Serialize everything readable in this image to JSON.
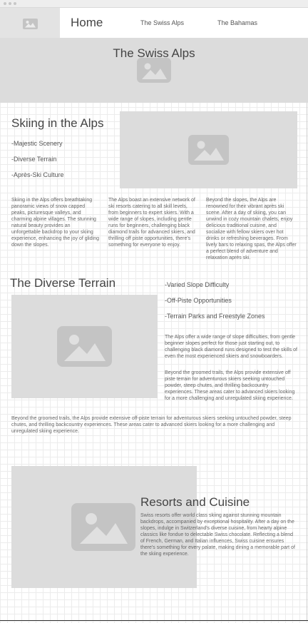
{
  "header": {
    "nav": [
      "Home",
      "The Swiss Alps",
      "The Bahamas"
    ]
  },
  "hero": {
    "title": "The Swiss Alps"
  },
  "skiing": {
    "title": "Skiing in the Alps",
    "bullets": [
      "-Majestic Scenery",
      "-Diverse Terrain",
      "-Après-Ski Culture"
    ],
    "columns": [
      "Skiing in the Alps offers breathtaking panoramic views of snow capped peaks, picturesque valleys, and charming alpine villages. The stunning natural beauty provides an unforgettable backdrop to your skiing experience, enhancing the joy of gliding down the slopes.",
      "The Alps boast an extensive network of ski resorts catering to all skill levels, from beginners to expert skiers. With a wide range of slopes, including gentle runs for beginners, challenging black diamond trails for advanced skiers, and thrilling off piste opportunities, there's something for everyone to enjoy.",
      "Beyond the slopes, the Alps are renowned for their vibrant après ski scene. After a day of skiing, you can unwind in cozy mountain chalets, enjoy delicious traditional cuisine, and socialize with fellow skiers over hot drinks or refreshing beverages. From lively bars to relaxing spas, the Alps offer a perfect blend of adventure and relaxation après ski."
    ]
  },
  "terrain": {
    "title": "The Diverse Terrain",
    "bullets": [
      "-Varied Slope Difficulty",
      "-Off-Piste Opportunities",
      "-Terrain Parks and Freestyle Zones"
    ],
    "para1": "The Alps offer a wide range of slope difficulties, from gentle beginner slopes perfect for those just starting out, to challenging black diamond runs designed to test the skills of even the most experienced skiers and snowboarders.",
    "para2": "Beyond the groomed trails, the Alps provide extensive off piste terrain for adventurous skiers seeking untouched powder, steep chutes, and thrilling backcountry experiences. These areas cater to advanced skiers looking for a more challenging and unregulated skiing experience.",
    "para3": "Beyond the groomed trails, the Alps provide extensive off-piste terrain for adventurous skiers seeking untouched powder, steep chutes, and thrilling backcountry experiences. These areas cater to advanced skiers looking for a more challenging and unregulated skiing experience."
  },
  "resorts": {
    "title": "Resorts and Cuisine",
    "text": "Swiss resorts offer world class skiing against stunning mountain backdrops, accompanied by exceptional hospitality. After a day on the slopes, indulge in Switzerland's diverse cuisine, from hearty alpine classics like fondue to delectable Swiss chocolate. Reflecting a blend of French, German, and Italian influences, Swiss cuisine ensures there's something for every palate, making dining a memorable part of the skiing experience."
  }
}
